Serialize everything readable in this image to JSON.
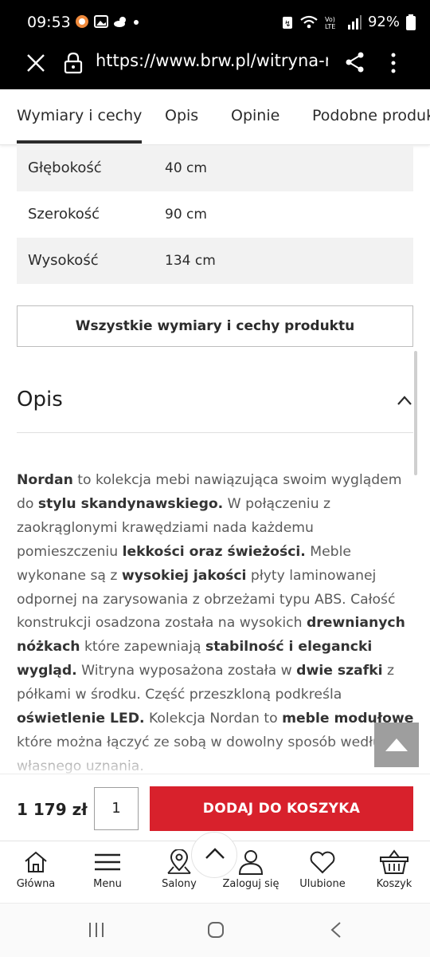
{
  "status_bar": {
    "time": "09:53",
    "battery": "92%"
  },
  "browser": {
    "url": "https://www.brw.pl/witryna-nordan"
  },
  "tabs": [
    {
      "label": "Wymiary i cechy",
      "active": true
    },
    {
      "label": "Opis",
      "active": false
    },
    {
      "label": "Opinie",
      "active": false
    },
    {
      "label": "Podobne produkty",
      "active": false
    }
  ],
  "specs": [
    {
      "name": "Głębokość",
      "value": "40 cm"
    },
    {
      "name": "Szerokość",
      "value": "90 cm"
    },
    {
      "name": "Wysokość",
      "value": "134 cm"
    }
  ],
  "all_specs_button": "Wszystkie wymiary i cechy produktu",
  "description": {
    "heading": "Opis",
    "segments": [
      {
        "text": "Nordan",
        "bold": true
      },
      {
        "text": " to kolekcja mebi nawiązująca swoim wyglądem do ",
        "bold": false
      },
      {
        "text": "stylu skandynawskiego.",
        "bold": true
      },
      {
        "text": " W połączeniu z zaokrąglonymi krawędziami nada każdemu pomieszczeniu ",
        "bold": false
      },
      {
        "text": "lekkości oraz świeżości.",
        "bold": true
      },
      {
        "text": " Meble wykonane są z ",
        "bold": false
      },
      {
        "text": "wysokiej jakości",
        "bold": true
      },
      {
        "text": " płyty laminowanej odpornej na zarysowania z obrzeżami typu ABS. Całość konstrukcji osadzona została na wysokich ",
        "bold": false
      },
      {
        "text": "drewnianych nóżkach",
        "bold": true
      },
      {
        "text": " które zapewniają ",
        "bold": false
      },
      {
        "text": "stabilność i elegancki wygląd.",
        "bold": true
      },
      {
        "text": " Witryna wyposażona została w ",
        "bold": false
      },
      {
        "text": "dwie szafki",
        "bold": true
      },
      {
        "text": " z półkami w środku. Część przeszkloną podkreśla ",
        "bold": false
      },
      {
        "text": "oświetlenie LED.",
        "bold": true
      },
      {
        "text": " Kolekcja Nordan to ",
        "bold": false
      },
      {
        "text": "meble modułowe",
        "bold": true
      },
      {
        "text": " które można łączyć ze sobą w dowolny sposób według własnego uznania.",
        "bold": false
      }
    ]
  },
  "purchase": {
    "price": "1 179 zł",
    "quantity": "1",
    "add_to_cart_label": "DODAJ DO KOSZYKA"
  },
  "bottom_nav": [
    {
      "label": "Główna",
      "icon": "home-icon"
    },
    {
      "label": "Menu",
      "icon": "menu-icon"
    },
    {
      "label": "Salony",
      "icon": "map-pin-icon"
    },
    {
      "label": "Zaloguj się",
      "icon": "user-icon"
    },
    {
      "label": "Ulubione",
      "icon": "heart-icon"
    },
    {
      "label": "Koszyk",
      "icon": "basket-icon"
    }
  ],
  "colors": {
    "accent_red": "#d8212c",
    "text_dark": "#2b2b2b",
    "row_shade": "#f2f2f2",
    "scroll_top_button": "#9e9e9e"
  }
}
